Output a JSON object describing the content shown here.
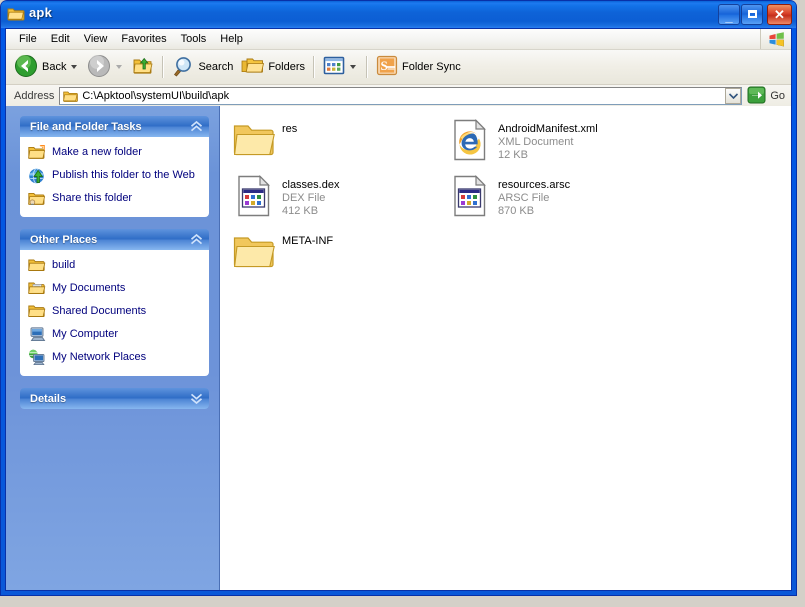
{
  "window": {
    "title": "apk",
    "title_icon": "folder-icon",
    "controls": {
      "minimize": "_",
      "maximize": "□",
      "close": "✕"
    }
  },
  "menubar": {
    "items": [
      {
        "label": "File"
      },
      {
        "label": "Edit"
      },
      {
        "label": "View"
      },
      {
        "label": "Favorites"
      },
      {
        "label": "Tools"
      },
      {
        "label": "Help"
      }
    ],
    "logo": "windows-logo-icon"
  },
  "toolbar": {
    "back_label": "Back",
    "forward_label": "",
    "up_label": "",
    "search_label": "Search",
    "folders_label": "Folders",
    "views_label": "",
    "foldersync_label": "Folder Sync"
  },
  "address": {
    "label": "Address",
    "value": "C:\\Apktool\\systemUI\\build\\apk",
    "icon": "folder-icon",
    "go_label": "Go"
  },
  "sidebar": {
    "panels": [
      {
        "title": "File and Folder Tasks",
        "state": "expanded",
        "chevron": "chevron-up-icon",
        "items": [
          {
            "label": "Make a new folder",
            "icon": "new-folder-icon"
          },
          {
            "label": "Publish this folder to the Web",
            "icon": "publish-web-icon"
          },
          {
            "label": "Share this folder",
            "icon": "share-folder-icon"
          }
        ]
      },
      {
        "title": "Other Places",
        "state": "expanded",
        "chevron": "chevron-up-icon",
        "items": [
          {
            "label": "build",
            "icon": "folder-icon"
          },
          {
            "label": "My Documents",
            "icon": "my-documents-icon"
          },
          {
            "label": "Shared Documents",
            "icon": "shared-documents-icon"
          },
          {
            "label": "My Computer",
            "icon": "my-computer-icon"
          },
          {
            "label": "My Network Places",
            "icon": "network-places-icon"
          }
        ]
      },
      {
        "title": "Details",
        "state": "collapsed",
        "chevron": "chevron-down-icon",
        "items": []
      }
    ]
  },
  "files": [
    {
      "name": "res",
      "type": "",
      "size": "",
      "icon": "folder-icon"
    },
    {
      "name": "AndroidManifest.xml",
      "type": "XML Document",
      "size": "12 KB",
      "icon": "xml-document-icon"
    },
    {
      "name": "classes.dex",
      "type": "DEX File",
      "size": "412 KB",
      "icon": "generic-file-icon"
    },
    {
      "name": "resources.arsc",
      "type": "ARSC File",
      "size": "870 KB",
      "icon": "generic-file-icon"
    },
    {
      "name": "META-INF",
      "type": "",
      "size": "",
      "icon": "folder-icon"
    }
  ],
  "colors": {
    "title_blue": "#0a63d6",
    "sidebar_blue": "#6d93d9",
    "panel_header_blue": "#2f6dc6",
    "link_text": "#00007d",
    "meta_gray": "#8c8c8c",
    "close_red": "#d8402a",
    "desktop_gray": "#d4d0c8"
  }
}
